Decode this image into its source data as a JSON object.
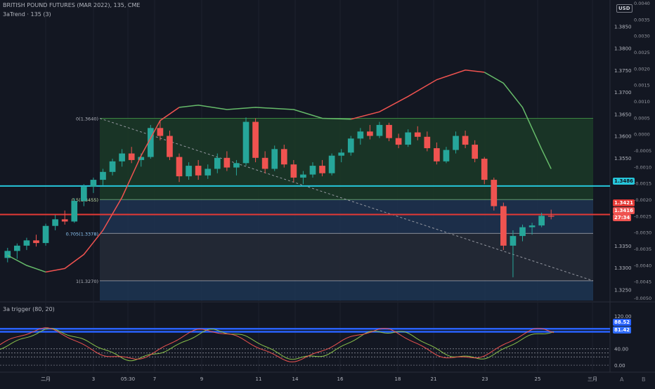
{
  "header": {
    "symbol_line": "BRITISH POUND FUTURES (MAR 2022), 135, CME",
    "indicator_line": "3aTrend · 135 (3)",
    "currency": "USD"
  },
  "oscillator": {
    "title": "3a trigger (80, 20)",
    "axis_ticks": [
      "120.00",
      "40.00",
      "0.00"
    ],
    "level_high": "88.52",
    "level_low": "81.42"
  },
  "right_axis_labels": [
    "1.3850",
    "1.3800",
    "1.3750",
    "1.3700",
    "1.3650",
    "1.3600",
    "1.3550",
    "1.3500",
    "1.3350",
    "1.3300",
    "1.3250"
  ],
  "secondary_axis_labels": [
    "0.0040",
    "0.0035",
    "0.0030",
    "0.0025",
    "0.0020",
    "0.0015",
    "0.0010",
    "0.0005",
    "0.0000",
    "-0.0005",
    "-0.0010",
    "-0.0015",
    "-0.0020",
    "-0.0025",
    "-0.0030",
    "-0.0035",
    "-0.0040",
    "-0.0045",
    "-0.0050"
  ],
  "price_tags": {
    "cyan": "1.3486",
    "red": "1.3421",
    "last": "1.3416",
    "countdown": "27:34"
  },
  "fib_labels": [
    "0(1.3640)",
    "0.5(1.3455)",
    "0.705(1.3378)",
    "1(1.3270)"
  ],
  "x_axis_labels": [
    "二月",
    "3",
    "05:30",
    "7",
    "9",
    "11",
    "14",
    "16",
    "18",
    "21",
    "23",
    "25",
    "三月"
  ],
  "bottom_toggles": [
    "A",
    "B"
  ],
  "colors": {
    "background": "#131722",
    "up": "#26a69a",
    "down": "#ef5350",
    "cyan_line": "#26c6da",
    "red_line": "#e53935",
    "trend_green": "#66bb6a",
    "trend_red": "#f05350",
    "osc_blue": "#2962ff"
  },
  "chart_data": {
    "type": "candlestick",
    "title": "BRITISH POUND FUTURES (MAR 2022), 135, CME",
    "ylim": [
      1.3225,
      1.39
    ],
    "x_ticks": [
      "二月",
      "3",
      "05:30",
      "7",
      "9",
      "11",
      "14",
      "16",
      "18",
      "21",
      "23",
      "25",
      "三月"
    ],
    "candles": [
      {
        "o": 1.3322,
        "h": 1.3345,
        "l": 1.3312,
        "c": 1.3338
      },
      {
        "o": 1.3338,
        "h": 1.3355,
        "l": 1.332,
        "c": 1.335
      },
      {
        "o": 1.335,
        "h": 1.3368,
        "l": 1.334,
        "c": 1.3362
      },
      {
        "o": 1.3362,
        "h": 1.3375,
        "l": 1.3348,
        "c": 1.3356
      },
      {
        "o": 1.3356,
        "h": 1.34,
        "l": 1.335,
        "c": 1.3395
      },
      {
        "o": 1.3395,
        "h": 1.342,
        "l": 1.3385,
        "c": 1.341
      },
      {
        "o": 1.341,
        "h": 1.343,
        "l": 1.3398,
        "c": 1.3405
      },
      {
        "o": 1.3405,
        "h": 1.3458,
        "l": 1.3402,
        "c": 1.3452
      },
      {
        "o": 1.3452,
        "h": 1.349,
        "l": 1.344,
        "c": 1.3484
      },
      {
        "o": 1.3484,
        "h": 1.3505,
        "l": 1.347,
        "c": 1.35
      },
      {
        "o": 1.35,
        "h": 1.3525,
        "l": 1.3488,
        "c": 1.3518
      },
      {
        "o": 1.3518,
        "h": 1.3548,
        "l": 1.351,
        "c": 1.3542
      },
      {
        "o": 1.3542,
        "h": 1.357,
        "l": 1.353,
        "c": 1.356
      },
      {
        "o": 1.356,
        "h": 1.3575,
        "l": 1.3538,
        "c": 1.3545
      },
      {
        "o": 1.3545,
        "h": 1.356,
        "l": 1.353,
        "c": 1.3552
      },
      {
        "o": 1.3552,
        "h": 1.3625,
        "l": 1.3548,
        "c": 1.3618
      },
      {
        "o": 1.3618,
        "h": 1.3635,
        "l": 1.359,
        "c": 1.36
      },
      {
        "o": 1.36,
        "h": 1.3612,
        "l": 1.3545,
        "c": 1.3552
      },
      {
        "o": 1.3552,
        "h": 1.356,
        "l": 1.3495,
        "c": 1.3508
      },
      {
        "o": 1.3508,
        "h": 1.354,
        "l": 1.35,
        "c": 1.3532
      },
      {
        "o": 1.3532,
        "h": 1.3545,
        "l": 1.35,
        "c": 1.351
      },
      {
        "o": 1.351,
        "h": 1.3535,
        "l": 1.3502,
        "c": 1.3525
      },
      {
        "o": 1.3525,
        "h": 1.356,
        "l": 1.3515,
        "c": 1.355
      },
      {
        "o": 1.355,
        "h": 1.3565,
        "l": 1.352,
        "c": 1.3528
      },
      {
        "o": 1.3528,
        "h": 1.3545,
        "l": 1.351,
        "c": 1.3538
      },
      {
        "o": 1.3538,
        "h": 1.3642,
        "l": 1.3532,
        "c": 1.3632
      },
      {
        "o": 1.3632,
        "h": 1.364,
        "l": 1.354,
        "c": 1.355
      },
      {
        "o": 1.355,
        "h": 1.3565,
        "l": 1.3515,
        "c": 1.3525
      },
      {
        "o": 1.3525,
        "h": 1.3578,
        "l": 1.352,
        "c": 1.357
      },
      {
        "o": 1.357,
        "h": 1.358,
        "l": 1.3528,
        "c": 1.3535
      },
      {
        "o": 1.3535,
        "h": 1.3545,
        "l": 1.3495,
        "c": 1.3505
      },
      {
        "o": 1.3505,
        "h": 1.352,
        "l": 1.349,
        "c": 1.3512
      },
      {
        "o": 1.3512,
        "h": 1.354,
        "l": 1.3505,
        "c": 1.3532
      },
      {
        "o": 1.3532,
        "h": 1.3545,
        "l": 1.3508,
        "c": 1.3515
      },
      {
        "o": 1.3515,
        "h": 1.356,
        "l": 1.351,
        "c": 1.3555
      },
      {
        "o": 1.3555,
        "h": 1.357,
        "l": 1.354,
        "c": 1.3562
      },
      {
        "o": 1.3562,
        "h": 1.36,
        "l": 1.3555,
        "c": 1.3594
      },
      {
        "o": 1.3594,
        "h": 1.3618,
        "l": 1.358,
        "c": 1.361
      },
      {
        "o": 1.361,
        "h": 1.3625,
        "l": 1.3592,
        "c": 1.36
      },
      {
        "o": 1.36,
        "h": 1.3632,
        "l": 1.3595,
        "c": 1.3625
      },
      {
        "o": 1.3625,
        "h": 1.363,
        "l": 1.3588,
        "c": 1.3595
      },
      {
        "o": 1.3595,
        "h": 1.3605,
        "l": 1.3572,
        "c": 1.358
      },
      {
        "o": 1.358,
        "h": 1.3615,
        "l": 1.3575,
        "c": 1.3608
      },
      {
        "o": 1.3608,
        "h": 1.3622,
        "l": 1.359,
        "c": 1.3598
      },
      {
        "o": 1.3598,
        "h": 1.361,
        "l": 1.3565,
        "c": 1.3572
      },
      {
        "o": 1.3572,
        "h": 1.3585,
        "l": 1.3535,
        "c": 1.3542
      },
      {
        "o": 1.3542,
        "h": 1.3575,
        "l": 1.3538,
        "c": 1.3568
      },
      {
        "o": 1.3568,
        "h": 1.361,
        "l": 1.356,
        "c": 1.36
      },
      {
        "o": 1.36,
        "h": 1.3612,
        "l": 1.3572,
        "c": 1.358
      },
      {
        "o": 1.358,
        "h": 1.359,
        "l": 1.354,
        "c": 1.3548
      },
      {
        "o": 1.3548,
        "h": 1.3552,
        "l": 1.349,
        "c": 1.35
      },
      {
        "o": 1.35,
        "h": 1.3505,
        "l": 1.343,
        "c": 1.344
      },
      {
        "o": 1.344,
        "h": 1.3448,
        "l": 1.334,
        "c": 1.335
      },
      {
        "o": 1.335,
        "h": 1.3385,
        "l": 1.3278,
        "c": 1.3372
      },
      {
        "o": 1.3372,
        "h": 1.3398,
        "l": 1.336,
        "c": 1.3392
      },
      {
        "o": 1.3392,
        "h": 1.3402,
        "l": 1.3375,
        "c": 1.3396
      },
      {
        "o": 1.3396,
        "h": 1.3425,
        "l": 1.3392,
        "c": 1.3418
      },
      {
        "o": 1.3418,
        "h": 1.3432,
        "l": 1.341,
        "c": 1.3416
      }
    ],
    "trend_curve": [
      {
        "i": 0,
        "v": 1.3328
      },
      {
        "i": 2,
        "v": 1.3305
      },
      {
        "i": 4,
        "v": 1.329
      },
      {
        "i": 6,
        "v": 1.3298
      },
      {
        "i": 8,
        "v": 1.333
      },
      {
        "i": 10,
        "v": 1.3385
      },
      {
        "i": 12,
        "v": 1.346
      },
      {
        "i": 14,
        "v": 1.3555
      },
      {
        "i": 16,
        "v": 1.3635
      },
      {
        "i": 18,
        "v": 1.3665
      },
      {
        "i": 20,
        "v": 1.367
      },
      {
        "i": 23,
        "v": 1.366
      },
      {
        "i": 26,
        "v": 1.3665
      },
      {
        "i": 30,
        "v": 1.366
      },
      {
        "i": 33,
        "v": 1.364
      },
      {
        "i": 36,
        "v": 1.3638
      },
      {
        "i": 39,
        "v": 1.3655
      },
      {
        "i": 42,
        "v": 1.369
      },
      {
        "i": 45,
        "v": 1.3728
      },
      {
        "i": 48,
        "v": 1.375
      },
      {
        "i": 50,
        "v": 1.3745
      },
      {
        "i": 52,
        "v": 1.372
      },
      {
        "i": 54,
        "v": 1.3665
      },
      {
        "i": 56,
        "v": 1.357
      },
      {
        "i": 57,
        "v": 1.3525
      }
    ],
    "fib_levels": [
      {
        "ratio": 0,
        "price": 1.364
      },
      {
        "ratio": 0.5,
        "price": 1.3455
      },
      {
        "ratio": 0.705,
        "price": 1.3378
      },
      {
        "ratio": 1,
        "price": 1.327
      }
    ],
    "horizontal_lines": [
      {
        "name": "cyan",
        "price": 1.3486
      },
      {
        "name": "red",
        "price": 1.3421
      }
    ],
    "oscillator_levels": [
      81.42,
      88.52
    ]
  }
}
